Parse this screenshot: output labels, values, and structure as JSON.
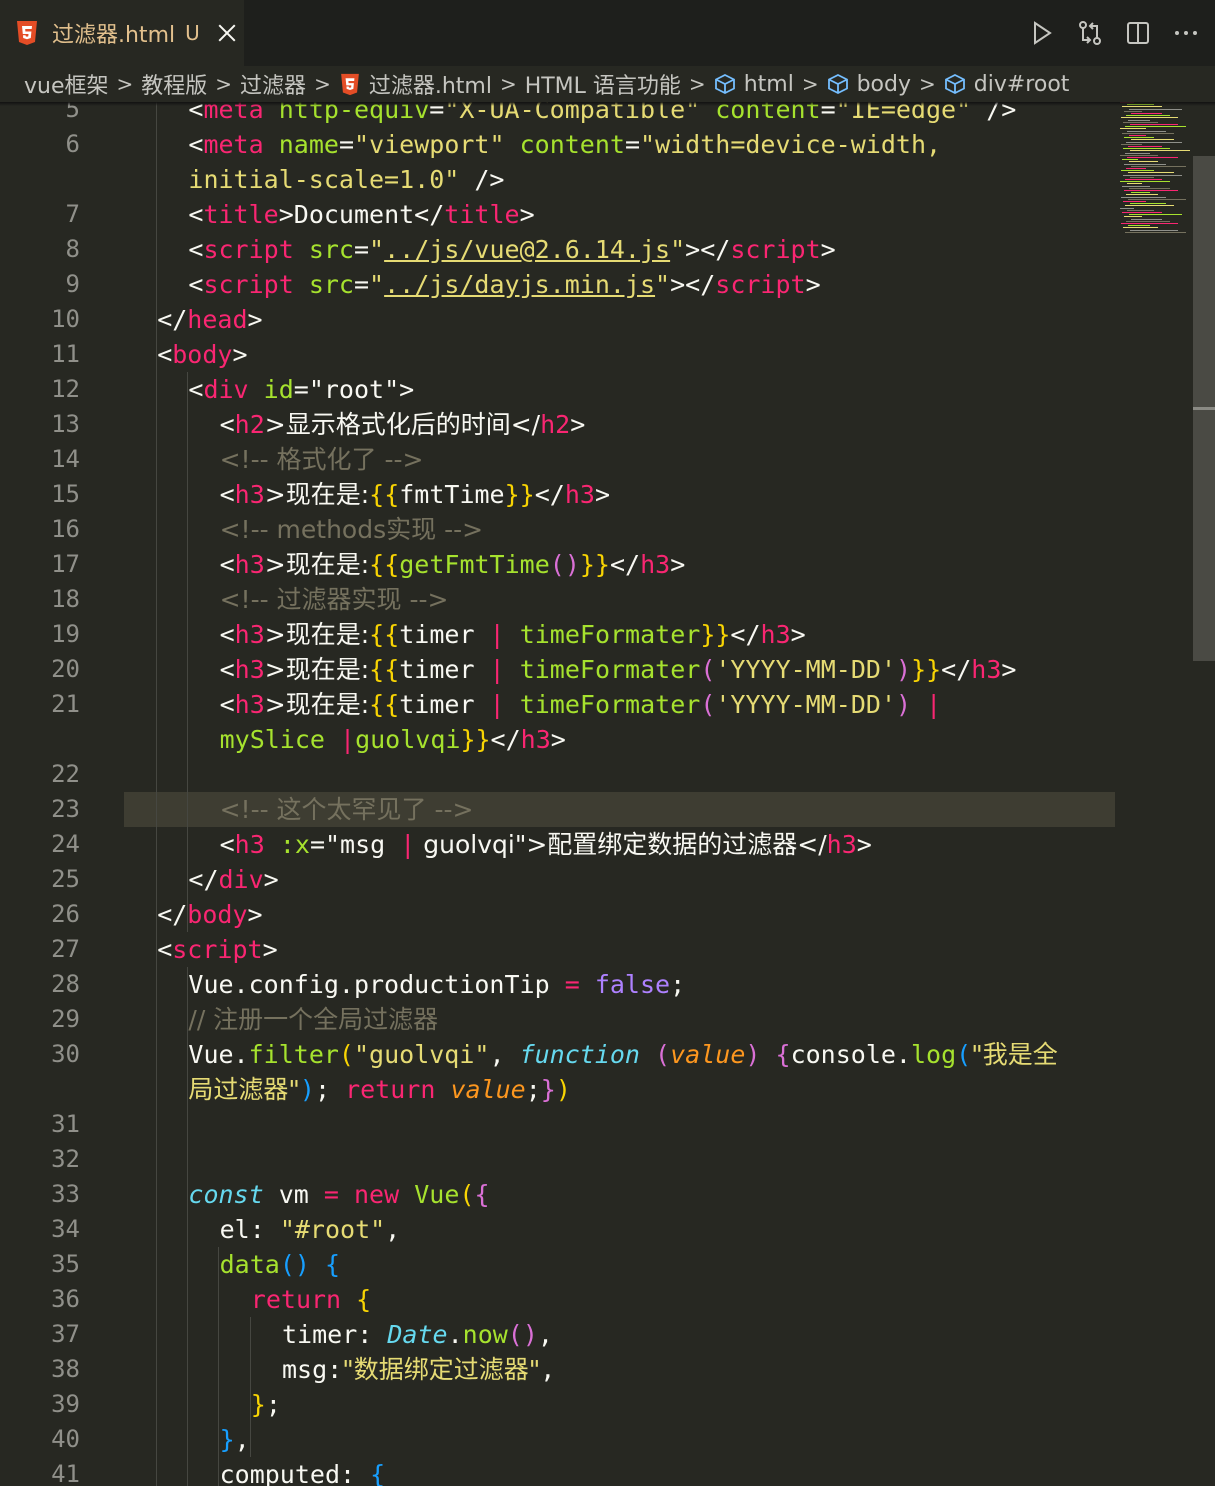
{
  "tab": {
    "filename": "过滤器.html",
    "status": "U"
  },
  "breadcrumb": {
    "items": [
      "vue框架",
      "教程版",
      "过滤器",
      "过滤器.html",
      "HTML 语言功能",
      "html",
      "body",
      "div#root"
    ],
    "separator": ">"
  },
  "icons": {
    "file_type": "html5-icon",
    "close": "close-icon",
    "run": "play-icon",
    "compare": "compare-changes-icon",
    "split": "split-editor-icon",
    "more": "more-actions-icon",
    "element": "cube-icon"
  },
  "colors": {
    "background": "#272822",
    "tag": "#f92672",
    "attribute": "#a6e22e",
    "string": "#e6db74",
    "comment": "#75715e",
    "modified": "#e2c08d"
  },
  "editor": {
    "current_line": 23,
    "lines": [
      {
        "n": "5",
        "tokens": [
          [
            "pn",
            "<"
          ],
          [
            "tg",
            "meta"
          ],
          [
            "pn",
            " "
          ],
          [
            "at",
            "http-equiv"
          ],
          [
            "pn",
            "="
          ],
          [
            "st",
            "\"X-UA-Compatible\""
          ],
          [
            "pn",
            " "
          ],
          [
            "at",
            "content"
          ],
          [
            "pn",
            "="
          ],
          [
            "st",
            "\"IE=edge\""
          ],
          [
            "pn",
            " />"
          ]
        ]
      },
      {
        "n": "6",
        "tokens": [
          [
            "pn",
            "<"
          ],
          [
            "tg",
            "meta"
          ],
          [
            "pn",
            " "
          ],
          [
            "at",
            "name"
          ],
          [
            "pn",
            "="
          ],
          [
            "st",
            "\"viewport\""
          ],
          [
            "pn",
            " "
          ],
          [
            "at",
            "content"
          ],
          [
            "pn",
            "="
          ],
          [
            "st",
            "\"width=device-width,"
          ]
        ]
      },
      {
        "n": "",
        "tokens": [
          [
            "st",
            "initial-scale=1.0\""
          ],
          [
            "pn",
            " />"
          ]
        ]
      },
      {
        "n": "7",
        "tokens": [
          [
            "pn",
            "<"
          ],
          [
            "tg",
            "title"
          ],
          [
            "pn",
            ">Document</"
          ],
          [
            "tg",
            "title"
          ],
          [
            "pn",
            ">"
          ]
        ]
      },
      {
        "n": "8",
        "tokens": [
          [
            "pn",
            "<"
          ],
          [
            "tg",
            "script"
          ],
          [
            "pn",
            " "
          ],
          [
            "at",
            "src"
          ],
          [
            "pn",
            "="
          ],
          [
            "st",
            "\""
          ],
          [
            "st ul",
            "../js/vue@2.6.14.js"
          ],
          [
            "st",
            "\""
          ],
          [
            "pn",
            "></"
          ],
          [
            "tg",
            "script"
          ],
          [
            "pn",
            ">"
          ]
        ]
      },
      {
        "n": "9",
        "tokens": [
          [
            "pn",
            "<"
          ],
          [
            "tg",
            "script"
          ],
          [
            "pn",
            " "
          ],
          [
            "at",
            "src"
          ],
          [
            "pn",
            "="
          ],
          [
            "st",
            "\""
          ],
          [
            "st ul",
            "../js/dayjs.min.js"
          ],
          [
            "st",
            "\""
          ],
          [
            "pn",
            "></"
          ],
          [
            "tg",
            "script"
          ],
          [
            "pn",
            ">"
          ]
        ]
      },
      {
        "n": "10",
        "tokens": [
          [
            "pn",
            "</"
          ],
          [
            "tg",
            "head"
          ],
          [
            "pn",
            ">"
          ]
        ]
      },
      {
        "n": "11",
        "tokens": [
          [
            "pn",
            "<"
          ],
          [
            "tg",
            "body"
          ],
          [
            "pn",
            ">"
          ]
        ]
      },
      {
        "n": "12",
        "tokens": [
          [
            "pn",
            "<"
          ],
          [
            "tg",
            "div"
          ],
          [
            "pn",
            " "
          ],
          [
            "at",
            "id"
          ],
          [
            "pn",
            "=\"root\">"
          ]
        ]
      },
      {
        "n": "13",
        "tokens": [
          [
            "pn",
            "<"
          ],
          [
            "tg",
            "h2"
          ],
          [
            "pn cjk",
            ">显示格式化后的时间</"
          ],
          [
            "tg",
            "h2"
          ],
          [
            "pn",
            ">"
          ]
        ]
      },
      {
        "n": "14",
        "tokens": [
          [
            "cm cjk",
            "<!-- 格式化了 -->"
          ]
        ]
      },
      {
        "n": "15",
        "tokens": [
          [
            "pn",
            "<"
          ],
          [
            "tg",
            "h3"
          ],
          [
            "pn cjk",
            ">现在是:"
          ],
          [
            "b1",
            "{{"
          ],
          [
            "pn",
            "fmtTime"
          ],
          [
            "b1",
            "}}"
          ],
          [
            "pn",
            "</"
          ],
          [
            "tg",
            "h3"
          ],
          [
            "pn",
            ">"
          ]
        ]
      },
      {
        "n": "16",
        "tokens": [
          [
            "cm cjk",
            "<!-- methods实现 -->"
          ]
        ]
      },
      {
        "n": "17",
        "tokens": [
          [
            "pn",
            "<"
          ],
          [
            "tg",
            "h3"
          ],
          [
            "pn cjk",
            ">现在是:"
          ],
          [
            "b1",
            "{{"
          ],
          [
            "fn",
            "getFmtTime"
          ],
          [
            "b2",
            "()"
          ],
          [
            "b1",
            "}}"
          ],
          [
            "pn",
            "</"
          ],
          [
            "tg",
            "h3"
          ],
          [
            "pn",
            ">"
          ]
        ]
      },
      {
        "n": "18",
        "tokens": [
          [
            "cm cjk",
            "<!-- 过滤器实现 -->"
          ]
        ]
      },
      {
        "n": "19",
        "tokens": [
          [
            "pn",
            "<"
          ],
          [
            "tg",
            "h3"
          ],
          [
            "pn cjk",
            ">现在是:"
          ],
          [
            "b1",
            "{{"
          ],
          [
            "pn",
            "timer "
          ],
          [
            "kw",
            "|"
          ],
          [
            "pn",
            " "
          ],
          [
            "fn",
            "timeFormater"
          ],
          [
            "b1",
            "}}"
          ],
          [
            "pn",
            "</"
          ],
          [
            "tg",
            "h3"
          ],
          [
            "pn",
            ">"
          ]
        ]
      },
      {
        "n": "20",
        "tokens": [
          [
            "pn",
            "<"
          ],
          [
            "tg",
            "h3"
          ],
          [
            "pn cjk",
            ">现在是:"
          ],
          [
            "b1",
            "{{"
          ],
          [
            "pn",
            "timer "
          ],
          [
            "kw",
            "|"
          ],
          [
            "pn",
            " "
          ],
          [
            "fn",
            "timeFormater"
          ],
          [
            "b2",
            "("
          ],
          [
            "st",
            "'YYYY-MM-DD'"
          ],
          [
            "b2",
            ")"
          ],
          [
            "b1",
            "}}"
          ],
          [
            "pn",
            "</"
          ],
          [
            "tg",
            "h3"
          ],
          [
            "pn",
            ">"
          ]
        ]
      },
      {
        "n": "21",
        "tokens": [
          [
            "pn",
            "<"
          ],
          [
            "tg",
            "h3"
          ],
          [
            "pn cjk",
            ">现在是:"
          ],
          [
            "b1",
            "{{"
          ],
          [
            "pn",
            "timer "
          ],
          [
            "kw",
            "|"
          ],
          [
            "pn",
            " "
          ],
          [
            "fn",
            "timeFormater"
          ],
          [
            "b2",
            "("
          ],
          [
            "st",
            "'YYYY-MM-DD'"
          ],
          [
            "b2",
            ")"
          ],
          [
            "pn",
            " "
          ],
          [
            "kw",
            "|"
          ]
        ]
      },
      {
        "n": "",
        "tokens": [
          [
            "fn",
            "mySlice"
          ],
          [
            "pn",
            " "
          ],
          [
            "kw",
            "|"
          ],
          [
            "fn",
            "guolvqi"
          ],
          [
            "b1",
            "}}"
          ],
          [
            "pn",
            "</"
          ],
          [
            "tg",
            "h3"
          ],
          [
            "pn",
            ">"
          ]
        ]
      },
      {
        "n": "22",
        "tokens": []
      },
      {
        "n": "23",
        "tokens": [
          [
            "cm cjk",
            "<!-- 这个太罕见了 -->"
          ]
        ]
      },
      {
        "n": "24",
        "tokens": [
          [
            "pn",
            "<"
          ],
          [
            "tg",
            "h3"
          ],
          [
            "pn",
            " "
          ],
          [
            "at",
            ":x"
          ],
          [
            "pn",
            "=\"msg "
          ],
          [
            "kw",
            "|"
          ],
          [
            "pn cjk",
            " guolvqi\">配置绑定数据的过滤器</"
          ],
          [
            "tg",
            "h3"
          ],
          [
            "pn",
            ">"
          ]
        ]
      },
      {
        "n": "25",
        "tokens": [
          [
            "pn",
            "</"
          ],
          [
            "tg",
            "div"
          ],
          [
            "pn",
            ">"
          ]
        ]
      },
      {
        "n": "26",
        "tokens": [
          [
            "pn",
            "</"
          ],
          [
            "tg",
            "body"
          ],
          [
            "pn",
            ">"
          ]
        ]
      },
      {
        "n": "27",
        "tokens": [
          [
            "pn",
            "<"
          ],
          [
            "tg",
            "script"
          ],
          [
            "pn",
            ">"
          ]
        ]
      },
      {
        "n": "28",
        "tokens": [
          [
            "pn",
            "Vue.config.productionTip "
          ],
          [
            "kw",
            "="
          ],
          [
            "pn",
            " "
          ],
          [
            "cn",
            "false"
          ],
          [
            "pn",
            ";"
          ]
        ]
      },
      {
        "n": "29",
        "tokens": [
          [
            "cm cjk",
            "// 注册一个全局过滤器"
          ]
        ]
      },
      {
        "n": "30",
        "tokens": [
          [
            "pn",
            "Vue."
          ],
          [
            "fn",
            "filter"
          ],
          [
            "b1",
            "("
          ],
          [
            "st",
            "\"guolvqi\""
          ],
          [
            "pn",
            ", "
          ],
          [
            "it",
            "function"
          ],
          [
            "pn",
            " "
          ],
          [
            "b2",
            "("
          ],
          [
            "ar",
            "value"
          ],
          [
            "b2",
            ")"
          ],
          [
            "pn",
            " "
          ],
          [
            "b2",
            "{"
          ],
          [
            "pn",
            "console."
          ],
          [
            "fn",
            "log"
          ],
          [
            "b3",
            "("
          ],
          [
            "st cjk",
            "\"我是全"
          ]
        ]
      },
      {
        "n": "",
        "tokens": [
          [
            "st cjk",
            "局过滤器\""
          ],
          [
            "b3",
            ")"
          ],
          [
            "pn",
            "; "
          ],
          [
            "kw",
            "return"
          ],
          [
            "pn",
            " "
          ],
          [
            "ar",
            "value"
          ],
          [
            "pn",
            ";"
          ],
          [
            "b2",
            "}"
          ],
          [
            "b1",
            ")"
          ]
        ]
      },
      {
        "n": "31",
        "tokens": []
      },
      {
        "n": "32",
        "tokens": []
      },
      {
        "n": "33",
        "tokens": [
          [
            "it",
            "const"
          ],
          [
            "pn",
            " vm "
          ],
          [
            "kw",
            "="
          ],
          [
            "pn",
            " "
          ],
          [
            "kw",
            "new"
          ],
          [
            "pn",
            " "
          ],
          [
            "fn",
            "Vue"
          ],
          [
            "b1",
            "("
          ],
          [
            "b2",
            "{"
          ]
        ]
      },
      {
        "n": "34",
        "tokens": [
          [
            "pn",
            "el: "
          ],
          [
            "st",
            "\"#root\""
          ],
          [
            "pn",
            ","
          ]
        ]
      },
      {
        "n": "35",
        "tokens": [
          [
            "fn",
            "data"
          ],
          [
            "b3",
            "()"
          ],
          [
            "pn",
            " "
          ],
          [
            "b3",
            "{"
          ]
        ]
      },
      {
        "n": "36",
        "tokens": [
          [
            "kw",
            "return"
          ],
          [
            "pn",
            " "
          ],
          [
            "b1",
            "{"
          ]
        ]
      },
      {
        "n": "37",
        "tokens": [
          [
            "pn",
            "timer: "
          ],
          [
            "it",
            "Date"
          ],
          [
            "pn",
            "."
          ],
          [
            "fn",
            "now"
          ],
          [
            "b2",
            "()"
          ],
          [
            "pn",
            ","
          ]
        ]
      },
      {
        "n": "38",
        "tokens": [
          [
            "pn",
            "msg:"
          ],
          [
            "st cjk",
            "\"数据绑定过滤器\""
          ],
          [
            "pn",
            ","
          ]
        ]
      },
      {
        "n": "39",
        "tokens": [
          [
            "b1",
            "}"
          ],
          [
            "pn",
            ";"
          ]
        ]
      },
      {
        "n": "40",
        "tokens": [
          [
            "b3",
            "}"
          ],
          [
            "pn",
            ","
          ]
        ]
      },
      {
        "n": "41",
        "tokens": [
          [
            "pn",
            "computed: "
          ],
          [
            "b3",
            "{"
          ]
        ]
      }
    ]
  }
}
